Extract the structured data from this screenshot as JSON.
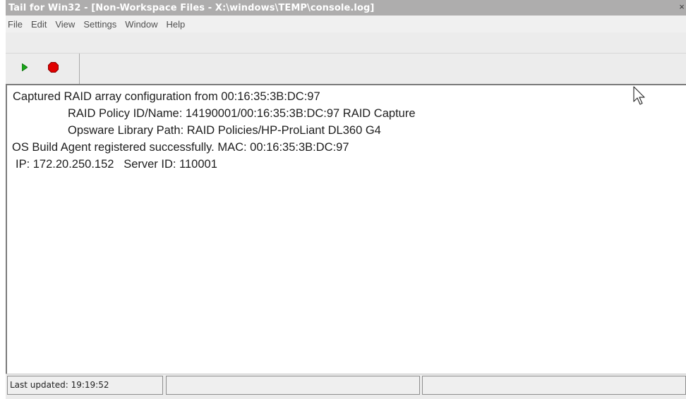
{
  "window": {
    "title": "Tail for Win32 - [Non-Workspace Files - X:\\windows\\TEMP\\console.log]",
    "close_glyph": "×"
  },
  "menu": {
    "items": [
      "File",
      "Edit",
      "View",
      "Settings",
      "Window",
      "Help"
    ]
  },
  "toolbar": {
    "start_icon": "play-icon",
    "stop_icon": "stop-icon",
    "colors": {
      "start": "#1aa51a",
      "stop": "#e00000"
    }
  },
  "log": {
    "lines": [
      "Captured RAID array configuration from 00:16:35:3B:DC:97",
      "RAID Policy ID/Name: 14190001/00:16:35:3B:DC:97 RAID Capture",
      "Opsware Library Path: RAID Policies/HP-ProLiant DL360 G4",
      "OS Build Agent registered successfully. MAC: 00:16:35:3B:DC:97",
      "IP: 172.20.250.152   Server ID: 110001"
    ]
  },
  "status": {
    "last_updated": "Last updated: 19:19:52",
    "pane2": "",
    "pane3": ""
  },
  "colors": {
    "titlebar": "#aeadad",
    "background": "#ffffff"
  }
}
